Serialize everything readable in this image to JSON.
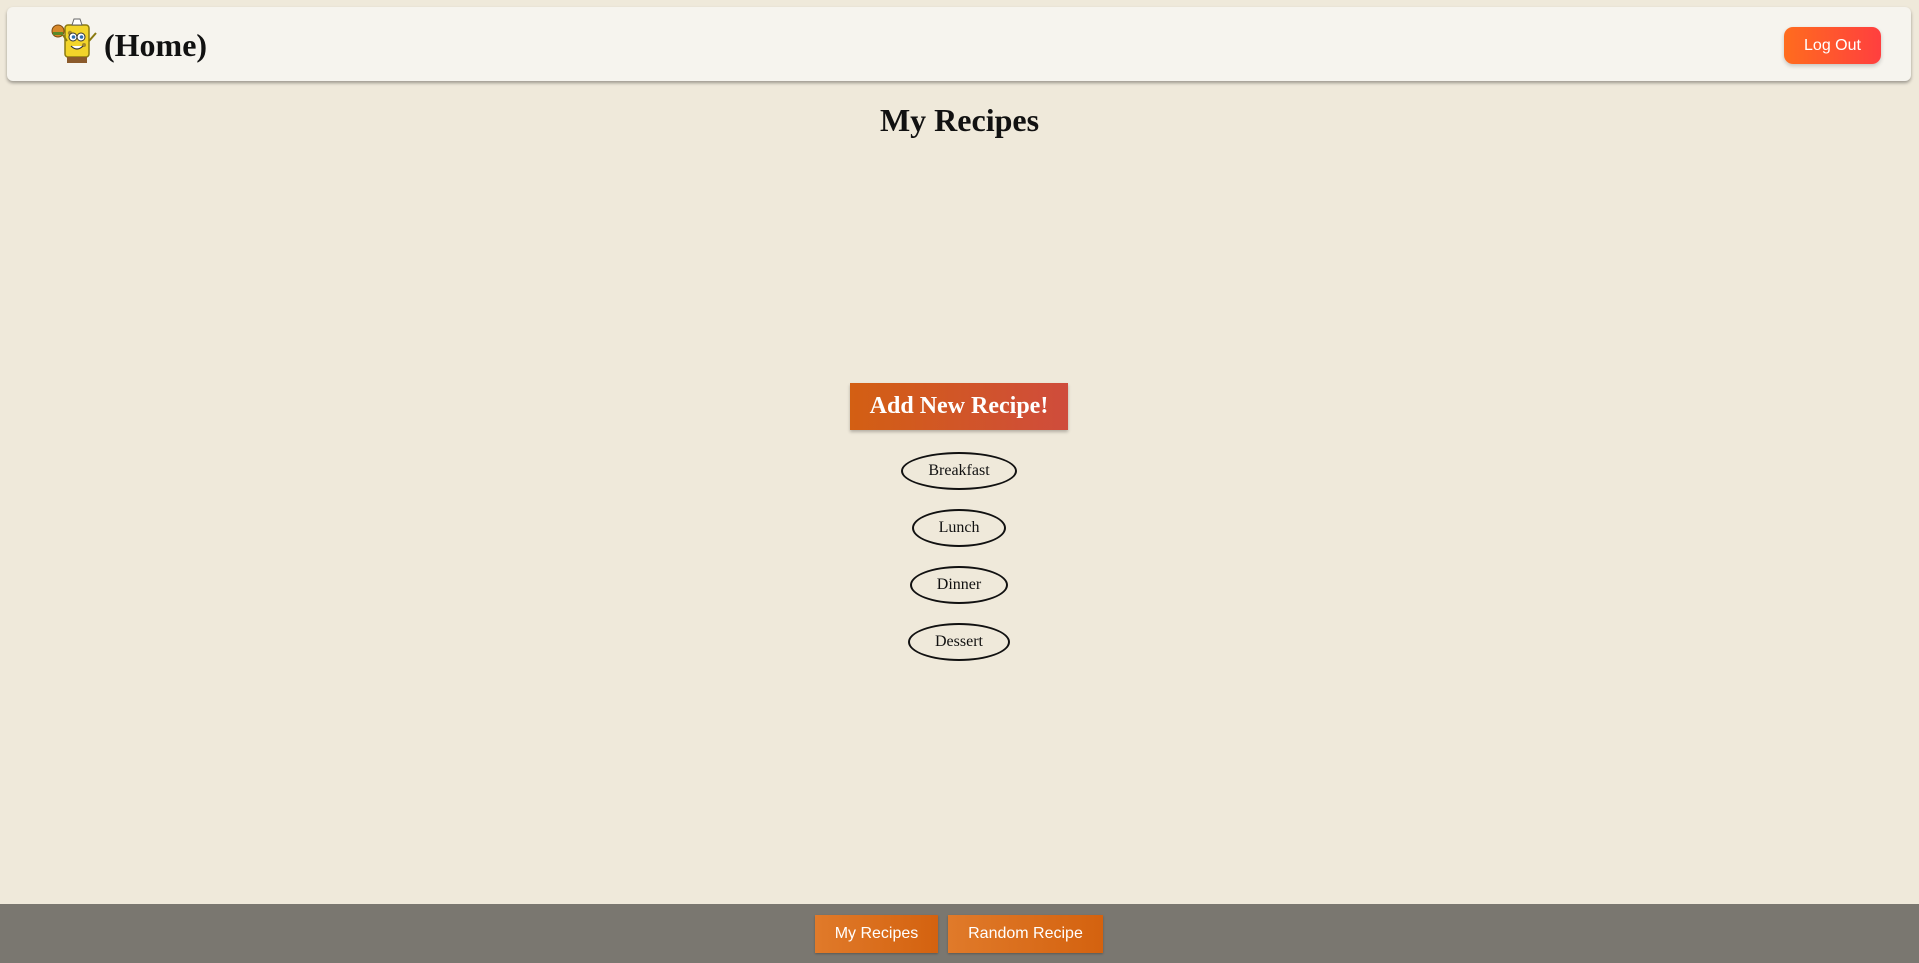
{
  "header": {
    "home_label": "(Home)",
    "logout_label": "Log Out"
  },
  "main": {
    "title": "My Recipes",
    "add_button_label": "Add New Recipe!",
    "categories": [
      "Breakfast",
      "Lunch",
      "Dinner",
      "Dessert"
    ]
  },
  "footer": {
    "my_recipes_label": "My Recipes",
    "random_recipe_label": "Random Recipe"
  },
  "colors": {
    "background": "#efe9da",
    "accent": "#d35f13",
    "footer": "#7a7770"
  }
}
